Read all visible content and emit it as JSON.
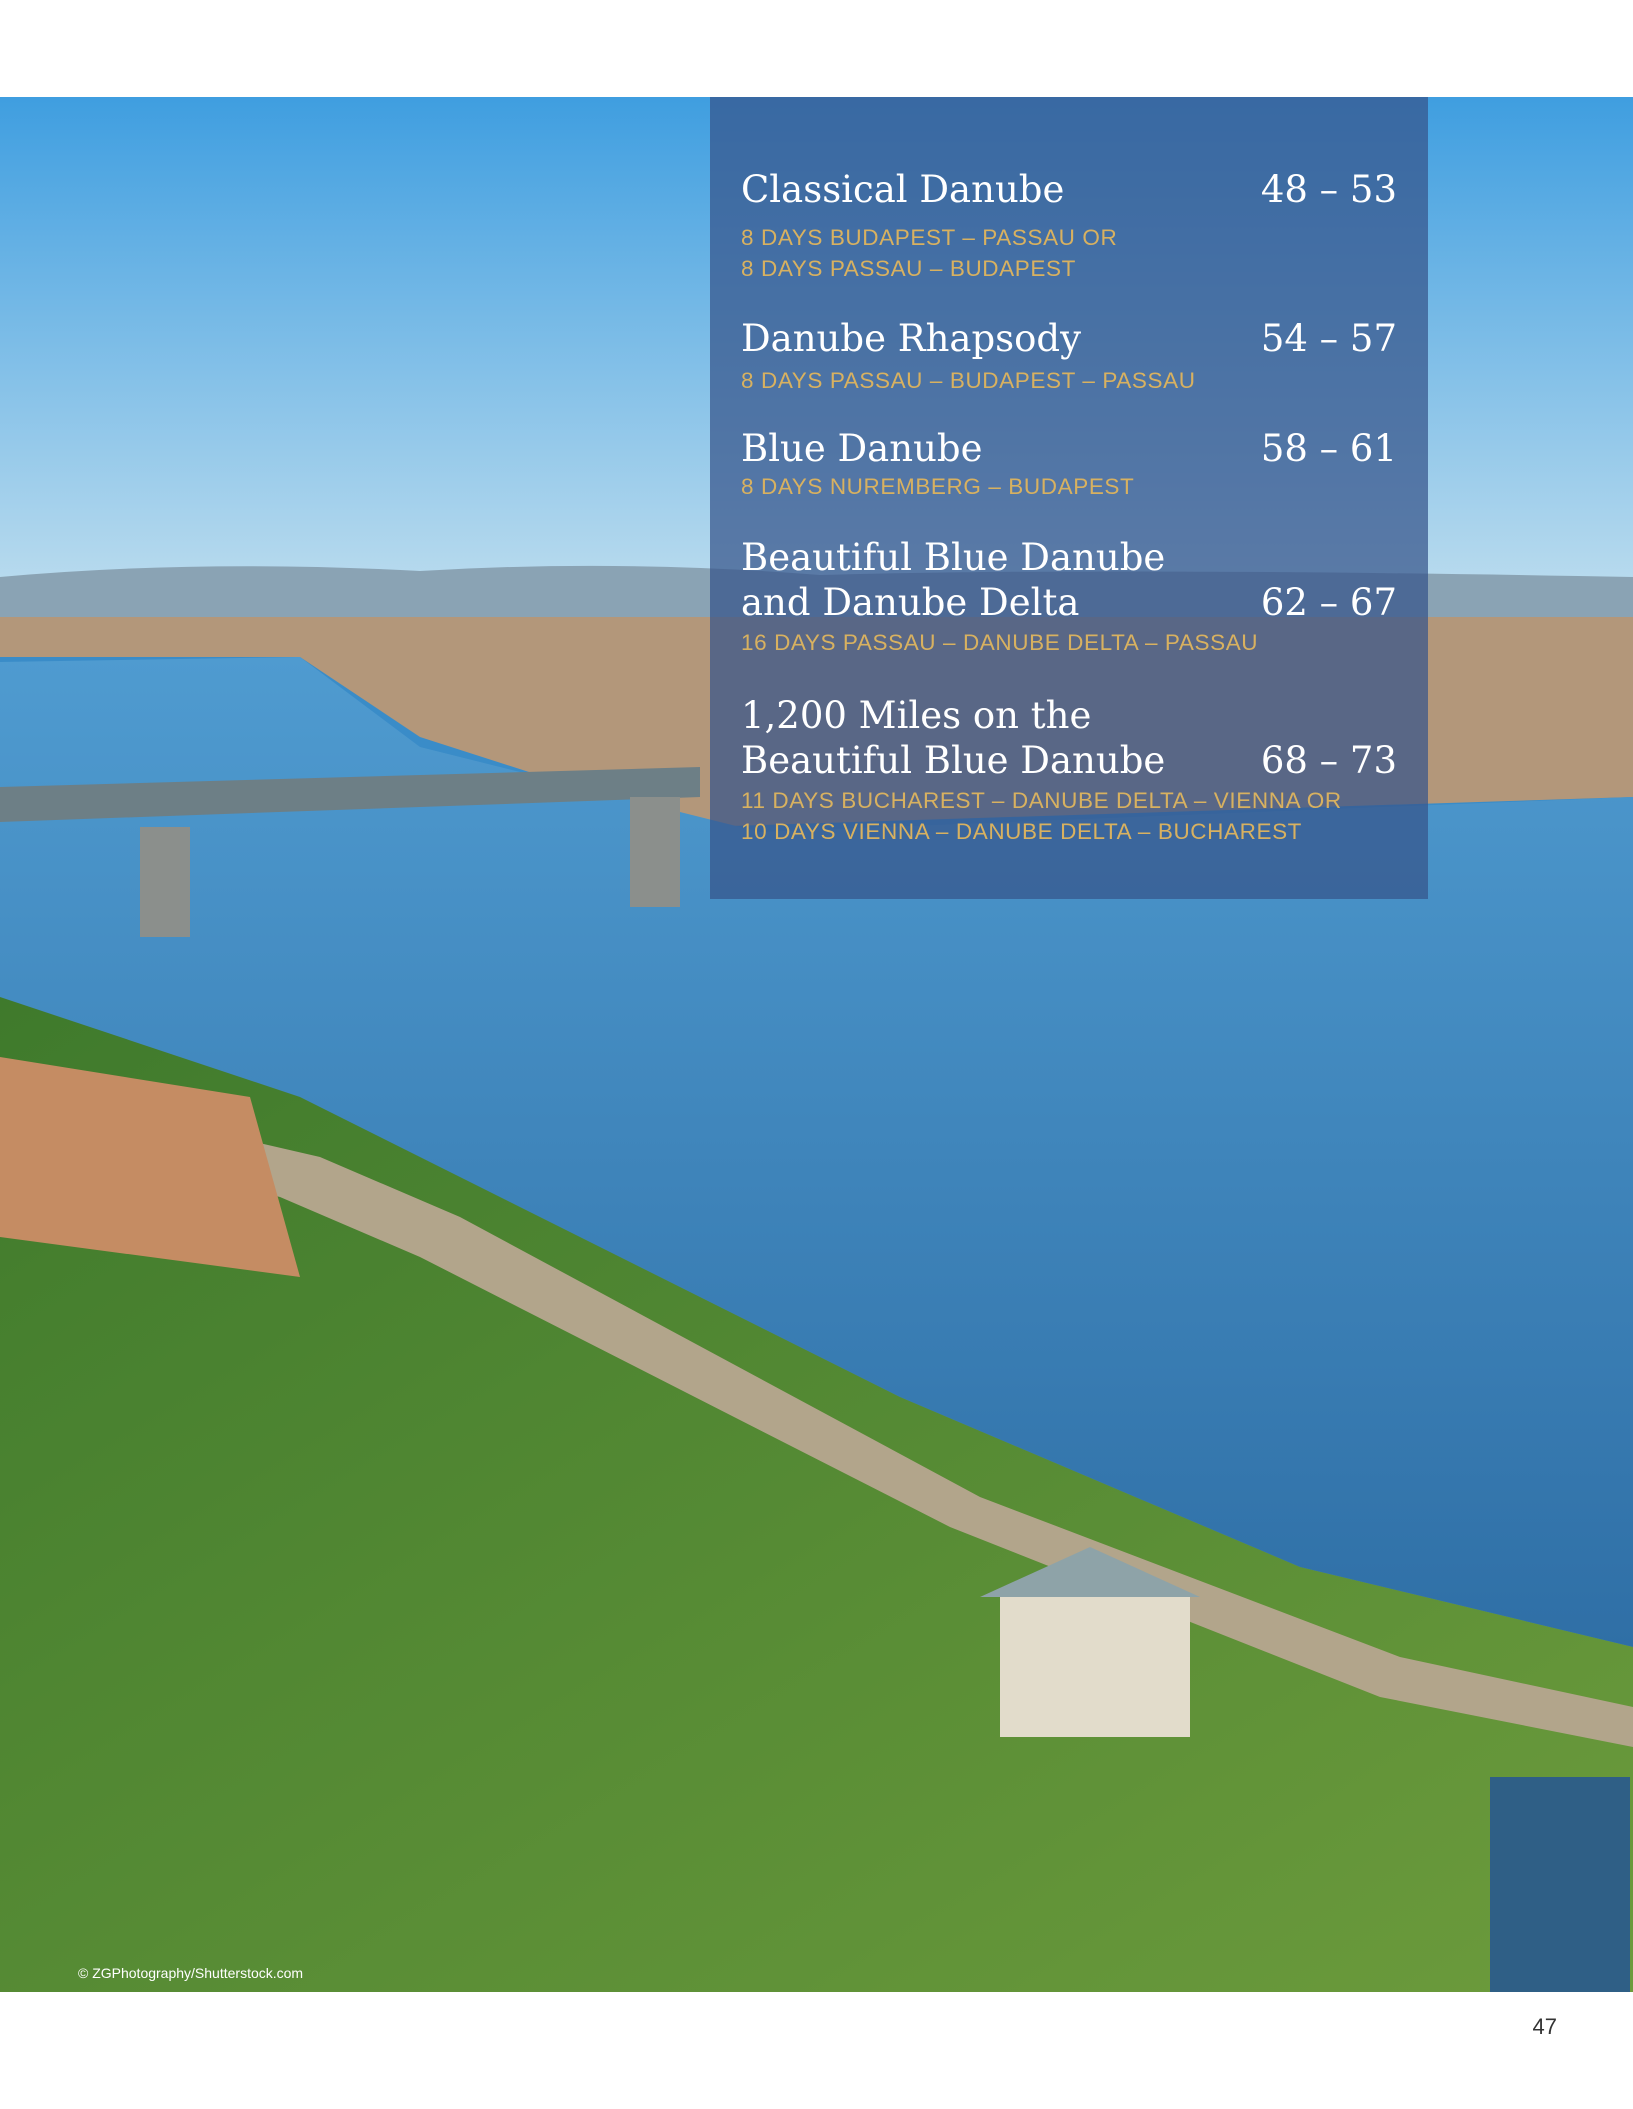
{
  "toc": {
    "entries": [
      {
        "title": "Classical Danube",
        "pages": "48 – 53",
        "subtitle": "8 DAYS BUDAPEST – PASSAU OR\n8 DAYS PASSAU – BUDAPEST"
      },
      {
        "title": "Danube Rhapsody",
        "pages": "54 – 57",
        "subtitle": "8 DAYS PASSAU – BUDAPEST – PASSAU"
      },
      {
        "title": "Blue Danube",
        "pages": "58 – 61",
        "subtitle": "8 DAYS NUREMBERG – BUDAPEST"
      },
      {
        "title": "Beautiful Blue Danube\nand Danube Delta",
        "pages": "62 – 67",
        "subtitle": "16 DAYS PASSAU – DANUBE DELTA – PASSAU"
      },
      {
        "title": "1,200 Miles on the\nBeautiful Blue Danube",
        "pages": "68 – 73",
        "subtitle": "11 DAYS BUCHAREST – DANUBE DELTA – VIENNA OR\n10 DAYS VIENNA – DANUBE DELTA – BUCHAREST"
      }
    ]
  },
  "photo_credit": "© ZGPhotography/Shutterstock.com",
  "page_number": "47",
  "colors": {
    "panel": "#36548a",
    "accent_gold": "#d8b160",
    "title": "#ffffff"
  }
}
